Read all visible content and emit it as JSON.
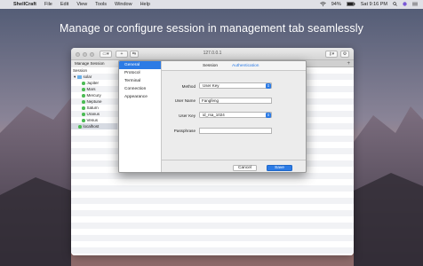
{
  "menubar": {
    "app_name": "ShellCraft",
    "items": [
      "File",
      "Edit",
      "View",
      "Tools",
      "Window",
      "Help"
    ],
    "battery": "94%",
    "clock": "Sat 9:16 PM"
  },
  "headline": "Manage or configure session in management tab seamlessly",
  "window": {
    "title": "127.0.0.1",
    "tab_label": "Manage Session",
    "tree_header": "Session",
    "tree": {
      "folder": "solar",
      "children": [
        "Jupiter",
        "Mars",
        "Mercury",
        "Neptune",
        "Saturn",
        "Uranus",
        "Venus"
      ],
      "other": "localhost"
    }
  },
  "dialog": {
    "sidebar": [
      "General",
      "Protocol",
      "Terminal",
      "Connection",
      "Appearance"
    ],
    "tabs": {
      "session": "Session",
      "authentication": "Authentication"
    },
    "method_label": "Method",
    "method_value": "User Key",
    "username_label": "User Name",
    "username_value": "Fangfeng",
    "userkey_label": "User Key",
    "userkey_value": "id_rsa_1024",
    "passphrase_label": "Passphrase",
    "passphrase_value": "",
    "cancel": "Cancel",
    "save": "Save"
  },
  "colors": {
    "accent": "#2c7be5",
    "status_green": "#4cbb55",
    "folder_blue": "#6ab0e8"
  }
}
